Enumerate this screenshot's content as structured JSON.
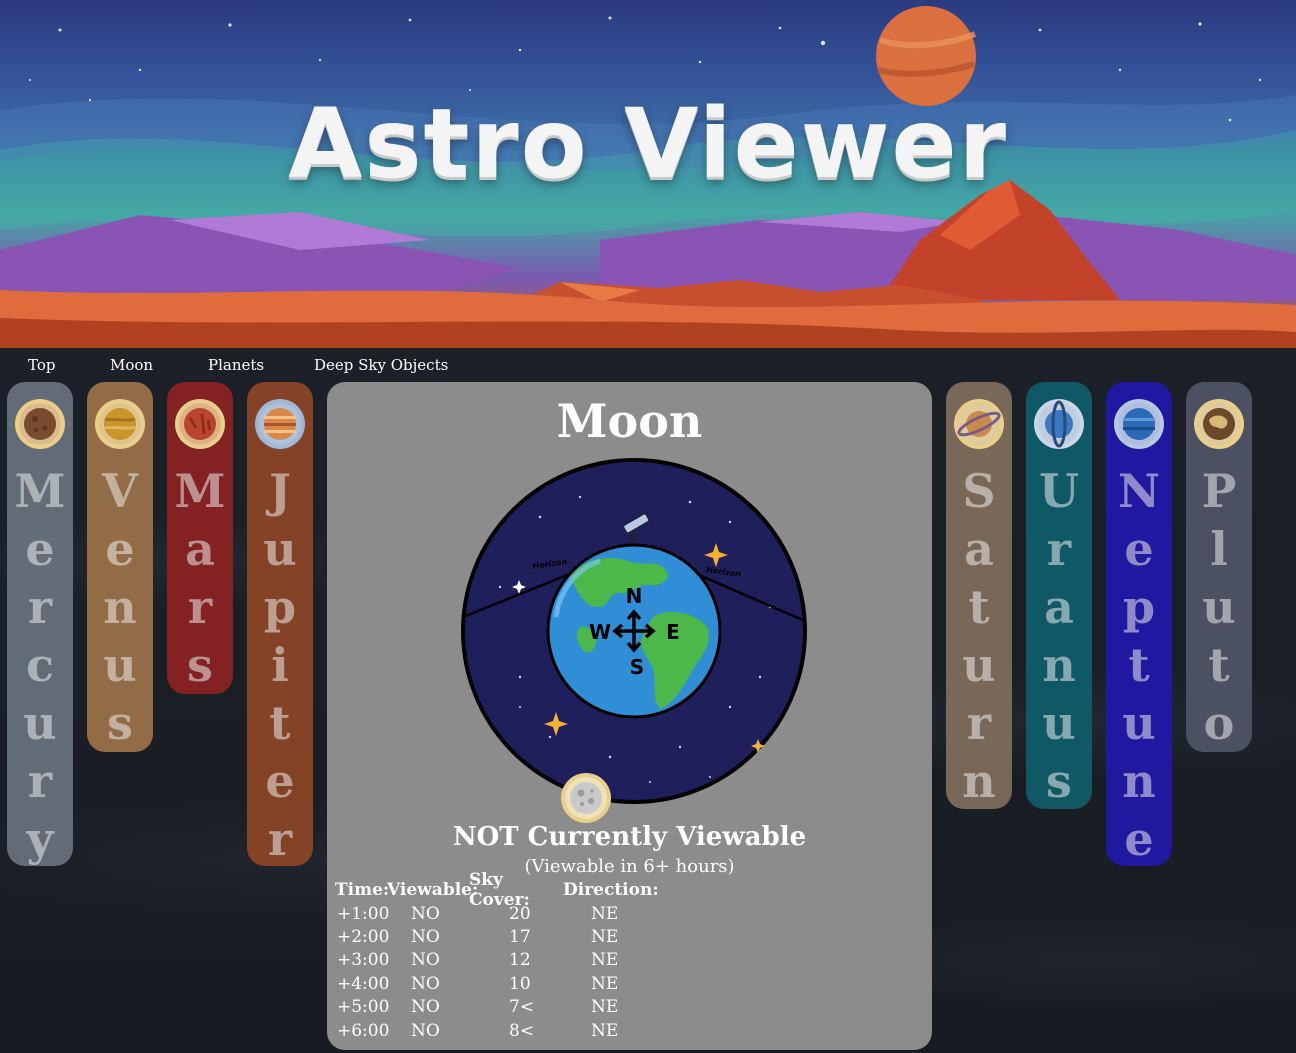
{
  "banner": {
    "title": "Astro Viewer"
  },
  "nav": [
    {
      "label": "Top"
    },
    {
      "label": "Moon"
    },
    {
      "label": "Planets"
    },
    {
      "label": "Deep Sky Objects"
    }
  ],
  "planets_left": [
    {
      "name": "Mercury",
      "letters": [
        "M",
        "e",
        "r",
        "c",
        "u",
        "r",
        "y"
      ],
      "color": "#6f7a86",
      "icon": "mercury-icon"
    },
    {
      "name": "Venus",
      "letters": [
        "V",
        "e",
        "n",
        "u",
        "s"
      ],
      "color": "#a0744a",
      "icon": "venus-icon"
    },
    {
      "name": "Mars",
      "letters": [
        "M",
        "a",
        "r",
        "s"
      ],
      "color": "#8a2222",
      "icon": "mars-icon"
    },
    {
      "name": "Jupiter",
      "letters": [
        "J",
        "u",
        "p",
        "i",
        "t",
        "e",
        "r"
      ],
      "color": "#8a4526",
      "icon": "jupiter-icon"
    }
  ],
  "planets_right": [
    {
      "name": "Saturn",
      "letters": [
        "S",
        "a",
        "t",
        "u",
        "r",
        "n"
      ],
      "color": "#8a7460",
      "icon": "saturn-icon"
    },
    {
      "name": "Uranus",
      "letters": [
        "U",
        "r",
        "a",
        "n",
        "u",
        "s"
      ],
      "color": "#0f5c68",
      "icon": "uranus-icon"
    },
    {
      "name": "Neptune",
      "letters": [
        "N",
        "e",
        "p",
        "t",
        "u",
        "n",
        "e"
      ],
      "color": "#2218a8",
      "icon": "neptune-icon"
    },
    {
      "name": "Pluto",
      "letters": [
        "P",
        "l",
        "u",
        "t",
        "o"
      ],
      "color": "#4e5464",
      "icon": "pluto-icon"
    }
  ],
  "moon_panel": {
    "title": "Moon",
    "sky": {
      "horizon_left": "Horizon",
      "horizon_right": "Horizon",
      "compass": [
        "N",
        "W",
        "E",
        "S"
      ]
    },
    "status": "NOT Currently Viewable",
    "substatus": "(Viewable in 6+ hours)",
    "forecast": {
      "headers": [
        "Time:",
        "Viewable:",
        "Sky Cover:",
        "Direction:"
      ],
      "rows": [
        [
          "+1:00",
          "NO",
          "20",
          "NE"
        ],
        [
          "+2:00",
          "NO",
          "17",
          "NE"
        ],
        [
          "+3:00",
          "NO",
          "12",
          "NE"
        ],
        [
          "+4:00",
          "NO",
          "10",
          "NE"
        ],
        [
          "+5:00",
          "NO",
          "7<",
          "NE"
        ],
        [
          "+6:00",
          "NO",
          "8<",
          "NE"
        ]
      ]
    }
  }
}
